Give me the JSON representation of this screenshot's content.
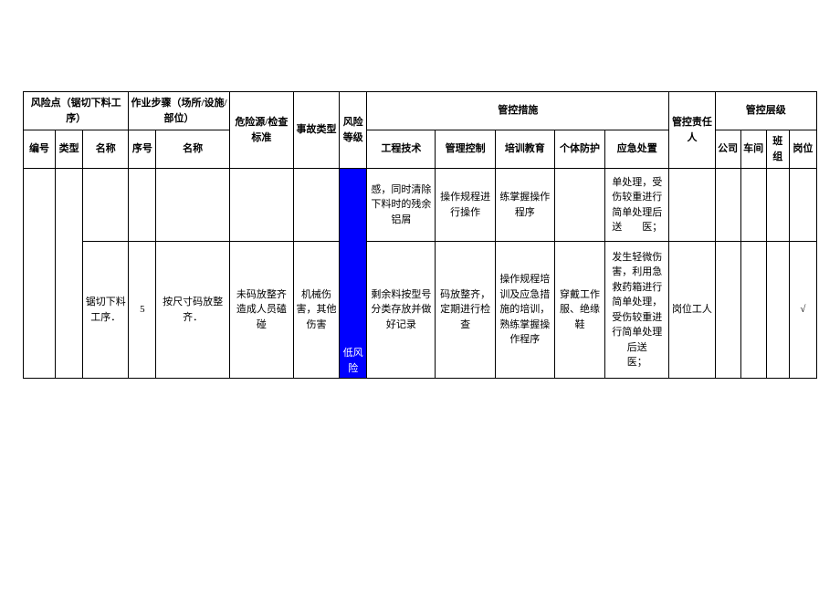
{
  "headers": {
    "risk_point": "风险点（锯切下料工序）",
    "work_step": "作业步骤（场所/设施/部位）",
    "hazard_check": "危险源/检查标准",
    "accident_type": "事故类型",
    "risk_level": "风险等级",
    "control_measures": "管控措施",
    "responsible": "管控责任人",
    "control_level": "管控层级",
    "rp_no": "编号",
    "rp_type": "类型",
    "rp_name": "名称",
    "ws_no": "序号",
    "ws_name": "名称",
    "cm_engineering": "工程技术",
    "cm_management": "管理控制",
    "cm_training": "培训教育",
    "cm_ppe": "个体防护",
    "cm_emergency": "应急处置",
    "cl_company": "公司",
    "cl_workshop": "车间",
    "cl_team": "班组",
    "cl_post": "岗位"
  },
  "rows": [
    {
      "engineering": "感，同时清除下料时的残余铝屑",
      "management": "操作规程进行操作",
      "training": "练掌握操作程序",
      "emergency": "单处理，受伤较重进行简单处理后送　　医；"
    },
    {
      "rp_name": "锯切下料工序．",
      "ws_no": "5",
      "ws_name": "按尺寸码放整齐．",
      "hazard": "未码放整齐造成人员磕碰",
      "accident": "机械伤害，其他伤害",
      "risk_level": "低风险",
      "engineering": "剩余料按型号分类存放并做好记录",
      "management": "码放整齐，定期进行检查",
      "training": "操作规程培训及应急措施的培训，熟练掌握操作程序",
      "ppe": "穿戴工作服、绝缘鞋",
      "emergency": "发生轻微伤害，利用急救药箱进行简单处理，受伤较重进行简单处理后送　　医；",
      "responsible": "岗位工人",
      "post": "√"
    }
  ]
}
